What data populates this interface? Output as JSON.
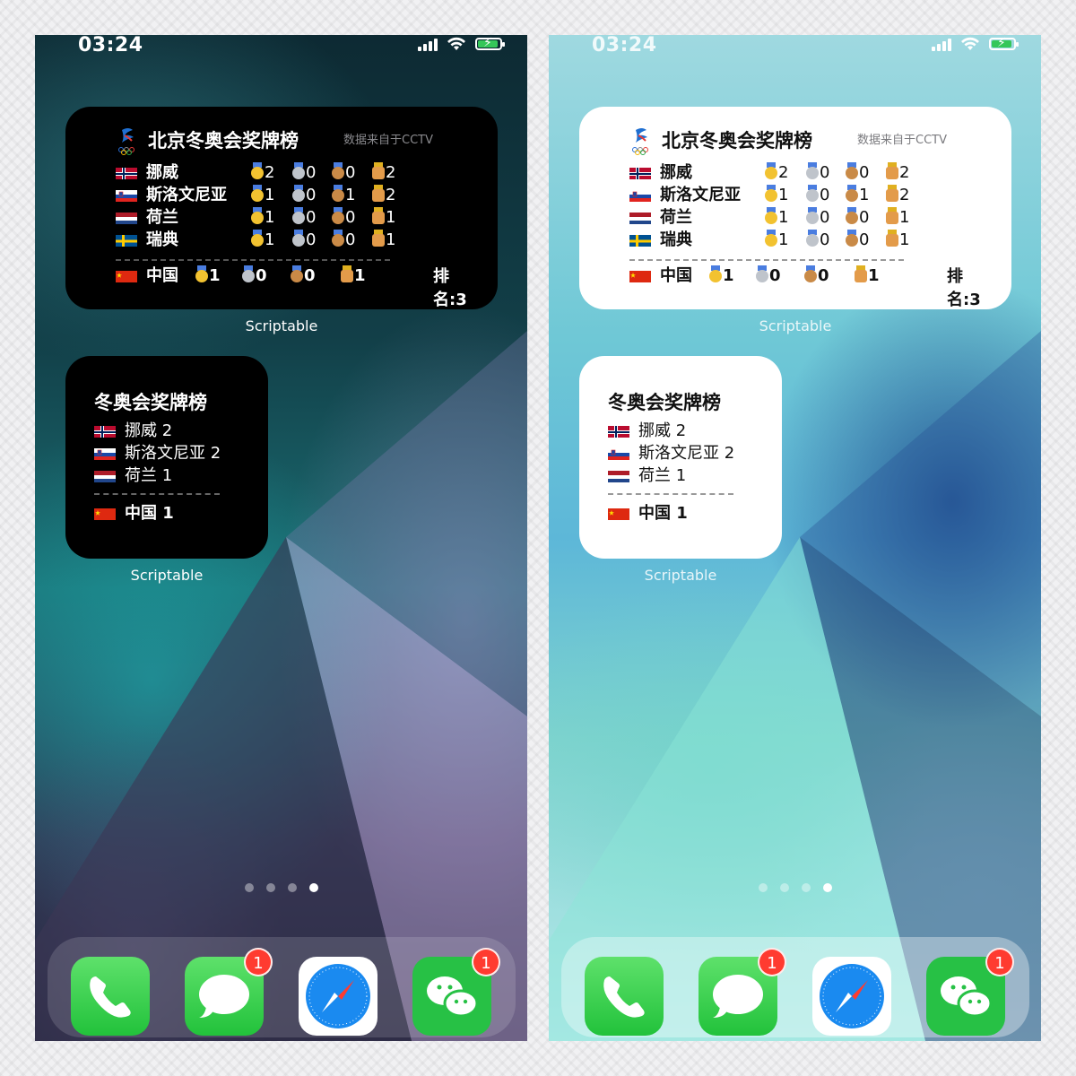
{
  "status": {
    "time": "03:24",
    "icons": [
      "cellular-signal-icon",
      "wifi-icon",
      "battery-charging-icon"
    ]
  },
  "large_widget": {
    "title": "北京冬奥会奖牌榜",
    "source": "数据来自于CCTV",
    "emblem": "beijing-2022-emblem",
    "rows": [
      {
        "country": "挪威",
        "flag": "norway",
        "gold": "2",
        "silver": "0",
        "bronze": "0",
        "total": "2"
      },
      {
        "country": "斯洛文尼亚",
        "flag": "slovenia",
        "gold": "1",
        "silver": "0",
        "bronze": "1",
        "total": "2"
      },
      {
        "country": "荷兰",
        "flag": "netherlands",
        "gold": "1",
        "silver": "0",
        "bronze": "0",
        "total": "1"
      },
      {
        "country": "瑞典",
        "flag": "sweden",
        "gold": "1",
        "silver": "0",
        "bronze": "0",
        "total": "1"
      }
    ],
    "china": {
      "country": "中国",
      "flag": "china",
      "gold": "1",
      "silver": "0",
      "bronze": "0",
      "total": "1",
      "rank": "排名:3"
    },
    "app_label": "Scriptable"
  },
  "small_widget": {
    "title": "冬奥会奖牌榜",
    "rows": [
      {
        "flag": "norway",
        "text": "挪威  2"
      },
      {
        "flag": "slovenia",
        "text": "斯洛文尼亚  2"
      },
      {
        "flag": "netherlands",
        "text": "荷兰  1"
      }
    ],
    "china": {
      "flag": "china",
      "text": "中国  1"
    },
    "app_label": "Scriptable"
  },
  "page_dots": {
    "count": 4,
    "active_index": 3
  },
  "dock": [
    {
      "app": "Phone",
      "icon": "phone-icon",
      "badge": ""
    },
    {
      "app": "Messages",
      "icon": "messages-icon",
      "badge": "1"
    },
    {
      "app": "Safari",
      "icon": "safari-compass-icon",
      "badge": ""
    },
    {
      "app": "WeChat",
      "icon": "wechat-icon",
      "badge": "1"
    }
  ],
  "colors": {
    "ios_green": "#35c759",
    "badge_red": "#ff3b30",
    "widget_dark": "#000000",
    "widget_light": "#ffffff"
  }
}
